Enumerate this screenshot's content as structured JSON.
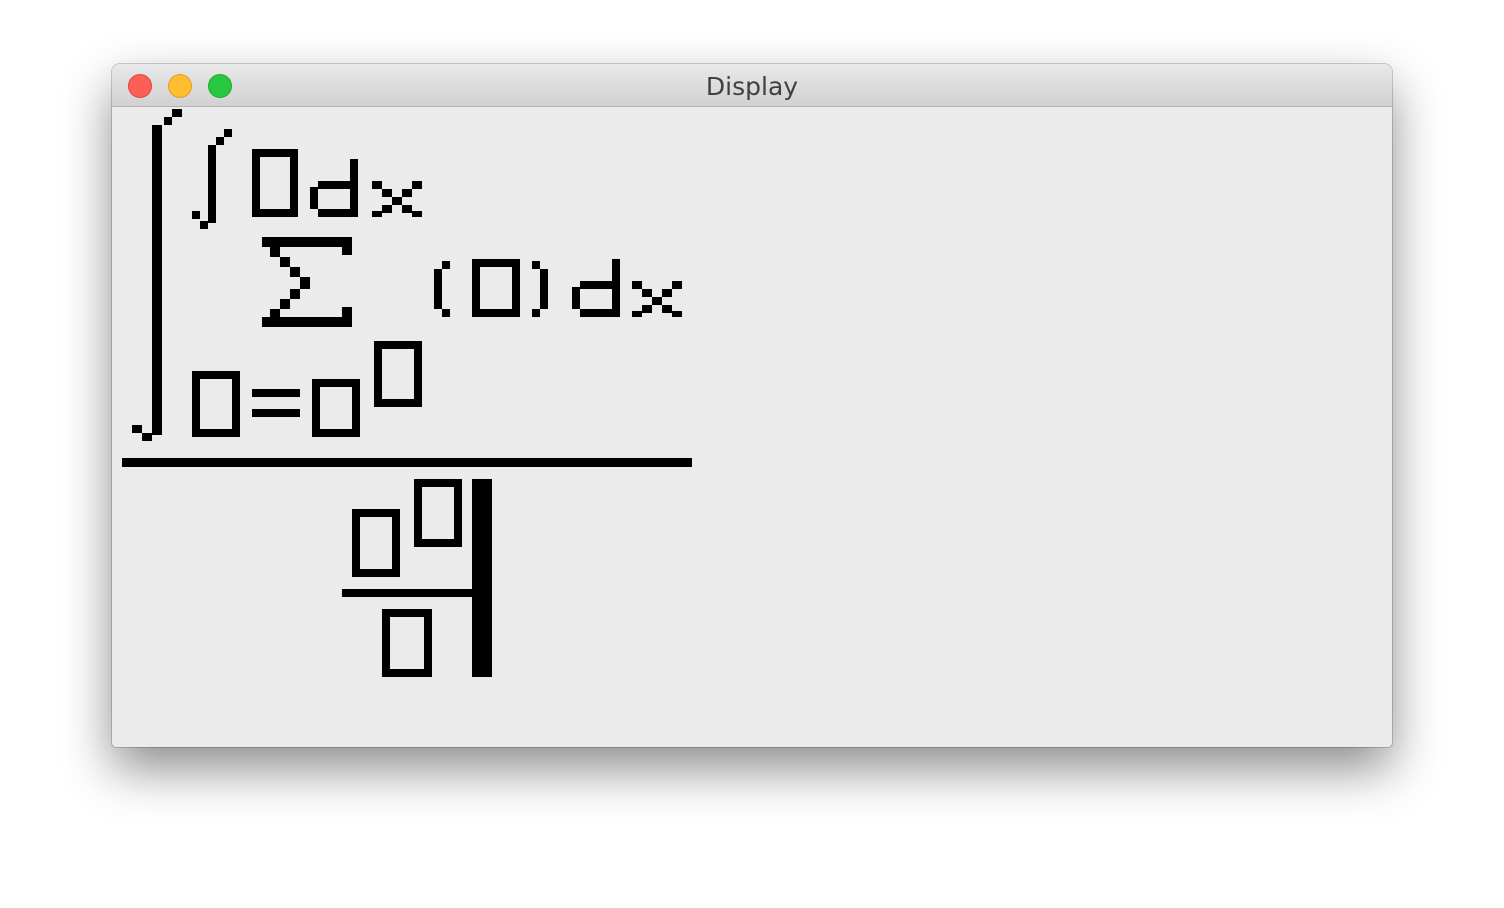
{
  "window": {
    "title": "Display"
  },
  "formula": {
    "description_glyphs": [
      "∫",
      "□",
      "dx",
      "Σ",
      "(□)",
      "dx",
      "□=□",
      "□"
    ],
    "fraction_bar": true
  }
}
